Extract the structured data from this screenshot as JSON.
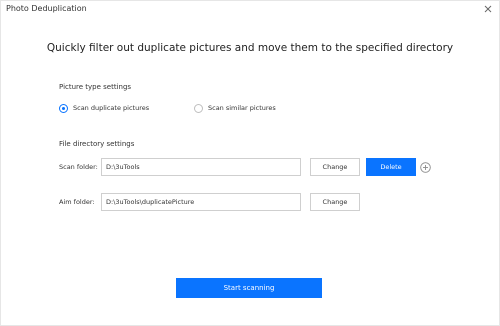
{
  "window": {
    "title": "Photo Deduplication",
    "close_icon": "close-icon"
  },
  "headline": "Quickly filter out duplicate pictures and move them to the specified directory",
  "picture_type": {
    "section_title": "Picture type settings",
    "options": [
      {
        "label": "Scan duplicate pictures",
        "checked": true
      },
      {
        "label": "Scan similar pictures",
        "checked": false
      }
    ]
  },
  "file_directory": {
    "section_title": "File directory settings",
    "scan_folder": {
      "label": "Scan folder:",
      "value": "D:\\3uTools",
      "change_label": "Change",
      "delete_label": "Delete",
      "add_icon": "add-circle-icon"
    },
    "aim_folder": {
      "label": "Aim folder:",
      "value": "D:\\3uTools\\duplicatePicture",
      "change_label": "Change"
    }
  },
  "start_button_label": "Start scanning",
  "colors": {
    "accent": "#0a74ff",
    "border": "#cfcfcf",
    "text": "#333333"
  }
}
